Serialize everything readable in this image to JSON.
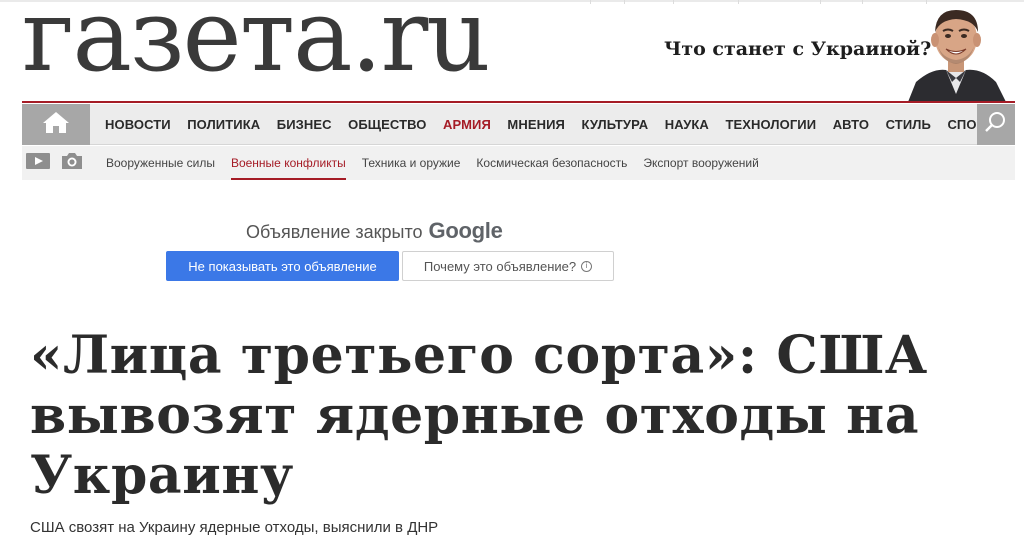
{
  "header": {
    "logo_text": "газета.ru",
    "promo_text": "Что станет с Украиной?"
  },
  "nav": {
    "items": [
      {
        "label": "НОВОСТИ",
        "active": false
      },
      {
        "label": "ПОЛИТИКА",
        "active": false
      },
      {
        "label": "БИЗНЕС",
        "active": false
      },
      {
        "label": "ОБЩЕСТВО",
        "active": false
      },
      {
        "label": "АРМИЯ",
        "active": true
      },
      {
        "label": "МНЕНИЯ",
        "active": false
      },
      {
        "label": "КУЛЬТУРА",
        "active": false
      },
      {
        "label": "НАУКА",
        "active": false
      },
      {
        "label": "ТЕХНОЛОГИИ",
        "active": false
      },
      {
        "label": "АВТО",
        "active": false
      },
      {
        "label": "СТИЛЬ",
        "active": false
      },
      {
        "label": "СПОРТ",
        "active": false
      }
    ],
    "home_icon": "home-icon",
    "search_icon": "search-icon"
  },
  "subnav": {
    "icons": [
      "video-icon",
      "camera-icon"
    ],
    "items": [
      {
        "label": "Вооруженные силы",
        "active": false
      },
      {
        "label": "Военные конфликты",
        "active": true
      },
      {
        "label": "Техника и оружие",
        "active": false
      },
      {
        "label": "Космическая безопасность",
        "active": false
      },
      {
        "label": "Экспорт вооружений",
        "active": false
      }
    ]
  },
  "ad": {
    "closed_text": "Объявление закрыто",
    "brand": "Google",
    "hide_label": "Не показывать это объявление",
    "why_label": "Почему это объявление?",
    "why_icon": "info-icon"
  },
  "article": {
    "headline_lines": [
      "«Лица третьего сорта»: США",
      "вывозят ядерные отходы на",
      "Украину"
    ],
    "subtitle": "США свозят на Украину ядерные отходы, выяснили в ДНР"
  },
  "colors": {
    "accent": "#a51c26",
    "nav_bg": "#ececec",
    "subnav_bg": "#f1f1f1",
    "nav_button_bg": "#a7a7a7",
    "ad_button_blue": "#3b78e7"
  }
}
